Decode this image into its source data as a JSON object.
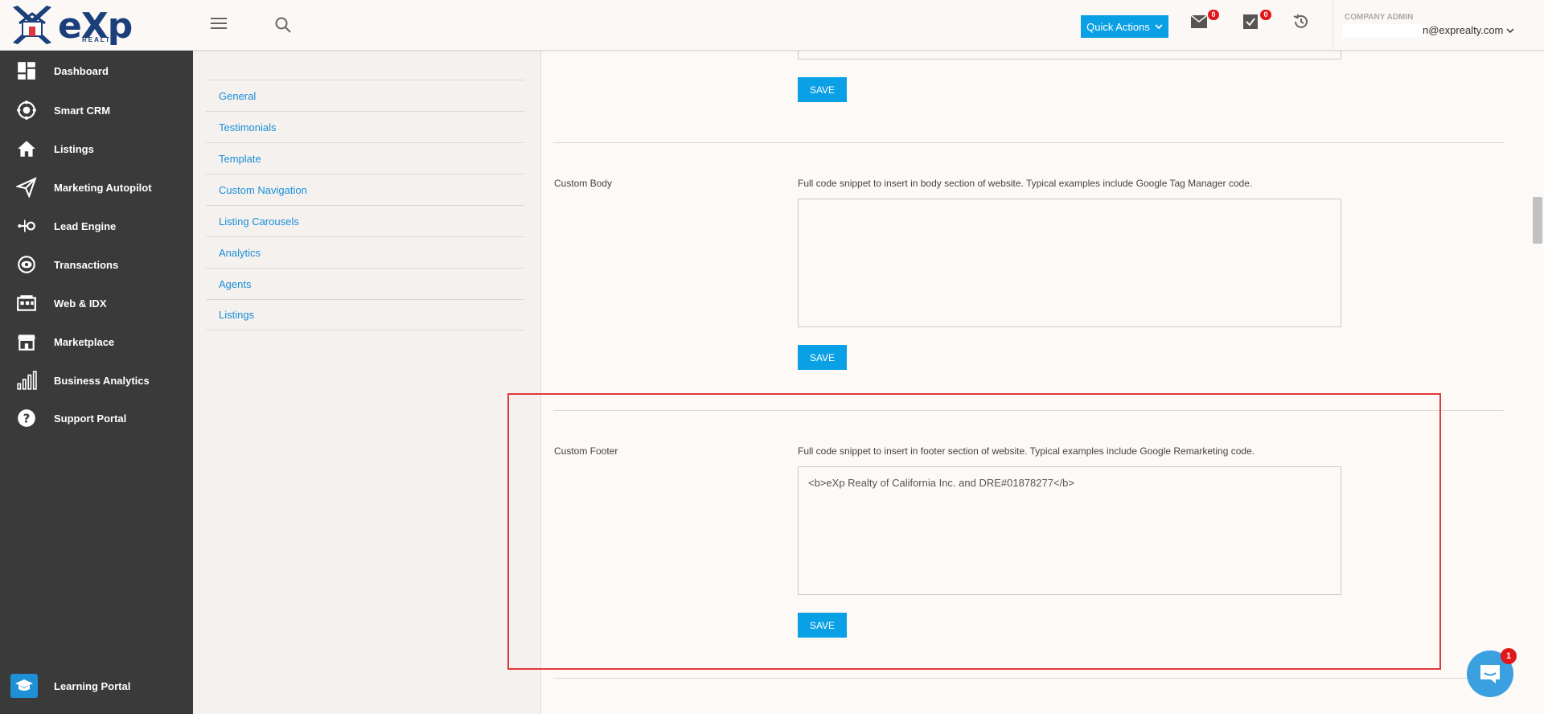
{
  "brand": {
    "logo_text": "eXp",
    "logo_sub": "REALTY"
  },
  "header": {
    "quick_actions_label": "Quick Actions",
    "mail_count": "0",
    "tasks_count": "0",
    "role": "COMPANY ADMIN",
    "user_email": "n@exprealty.com"
  },
  "sidebar": {
    "items": [
      {
        "label": "Dashboard",
        "icon": "dashboard-icon"
      },
      {
        "label": "Smart CRM",
        "icon": "crm-icon"
      },
      {
        "label": "Listings",
        "icon": "home-icon"
      },
      {
        "label": "Marketing Autopilot",
        "icon": "paper-plane-icon"
      },
      {
        "label": "Lead Engine",
        "icon": "lead-engine-icon"
      },
      {
        "label": "Transactions",
        "icon": "transactions-icon"
      },
      {
        "label": "Web & IDX",
        "icon": "web-idx-icon"
      },
      {
        "label": "Marketplace",
        "icon": "marketplace-icon"
      },
      {
        "label": "Business Analytics",
        "icon": "analytics-icon"
      },
      {
        "label": "Support Portal",
        "icon": "help-icon"
      }
    ],
    "learning_portal": {
      "label": "Learning Portal",
      "icon": "graduation-cap-icon"
    }
  },
  "subnav": {
    "items": [
      "General",
      "Testimonials",
      "Template",
      "Custom Navigation",
      "Listing Carousels",
      "Analytics",
      "Agents",
      "Listings"
    ]
  },
  "main": {
    "save_label": "SAVE",
    "custom_body": {
      "label": "Custom Body",
      "help": "Full code snippet to insert in body section of website. Typical examples include Google Tag Manager code.",
      "value": ""
    },
    "custom_footer": {
      "label": "Custom Footer",
      "help": "Full code snippet to insert in footer section of website. Typical examples include Google Remarketing code.",
      "value": "<b>eXp Realty of California Inc. and DRE#01878277</b>"
    }
  },
  "chat": {
    "badge": "1"
  },
  "colors": {
    "accent": "#0aa0e6",
    "sidebar": "#3a3a3a",
    "link": "#1a8fd8",
    "highlight": "#e0393c",
    "badge": "#e0171b"
  }
}
